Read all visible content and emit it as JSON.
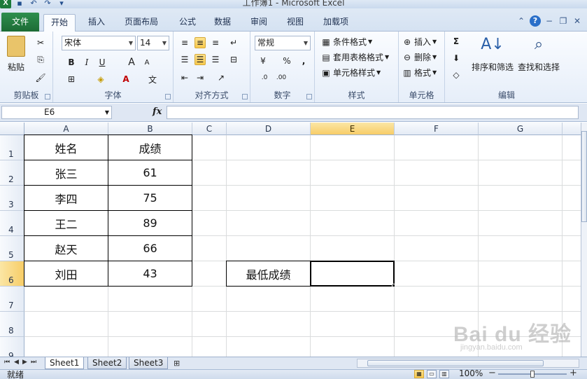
{
  "window": {
    "title": "工作簿1 - Microsoft Excel"
  },
  "tabs": [
    "文件",
    "开始",
    "插入",
    "页面布局",
    "公式",
    "数据",
    "审阅",
    "视图",
    "加载项"
  ],
  "ribbon": {
    "clipboard": {
      "paste": "粘贴",
      "label": "剪贴板"
    },
    "font": {
      "name": "宋体",
      "size": "14",
      "bold": "B",
      "italic": "I",
      "underline": "U",
      "grow": "A",
      "shrink": "A",
      "label": "字体"
    },
    "alignment": {
      "label": "对齐方式"
    },
    "number": {
      "format": "常规",
      "percent": "%",
      "comma": ",",
      "label": "数字"
    },
    "styles": {
      "conditional": "条件格式",
      "table": "套用表格格式",
      "cell": "单元格样式",
      "label": "样式"
    },
    "cells": {
      "insert": "插入",
      "delete": "删除",
      "format": "格式",
      "label": "单元格"
    },
    "editing": {
      "sum": "Σ",
      "sort": "排序和筛选",
      "find": "查找和选择",
      "label": "编辑"
    }
  },
  "formula_bar": {
    "name_box": "E6",
    "fx": "fx",
    "value": ""
  },
  "columns": [
    "A",
    "B",
    "C",
    "D",
    "E",
    "F",
    "G"
  ],
  "rows": [
    "1",
    "2",
    "3",
    "4",
    "5",
    "6",
    "7",
    "8",
    "9"
  ],
  "selected": {
    "column": "E",
    "row": "6",
    "cell": "E6"
  },
  "cells": {
    "A1": "姓名",
    "B1": "成绩",
    "A2": "张三",
    "B2": "61",
    "A3": "李四",
    "B3": "75",
    "A4": "王二",
    "B4": "89",
    "A5": "赵天",
    "B5": "66",
    "A6": "刘田",
    "B6": "43",
    "D6": "最低成绩",
    "E6": ""
  },
  "sheets": [
    "Sheet1",
    "Sheet2",
    "Sheet3"
  ],
  "active_sheet": "Sheet1",
  "status": {
    "ready": "就绪",
    "zoom": "100%",
    "minus": "−",
    "plus": "+"
  },
  "watermark": {
    "main": "Bai du 经验",
    "sub": "jingyan.baidu.com"
  },
  "colors": {
    "file_tab": "#1c6b35",
    "selection_header": "#f7cd68",
    "grid_line": "#dadcdd"
  }
}
